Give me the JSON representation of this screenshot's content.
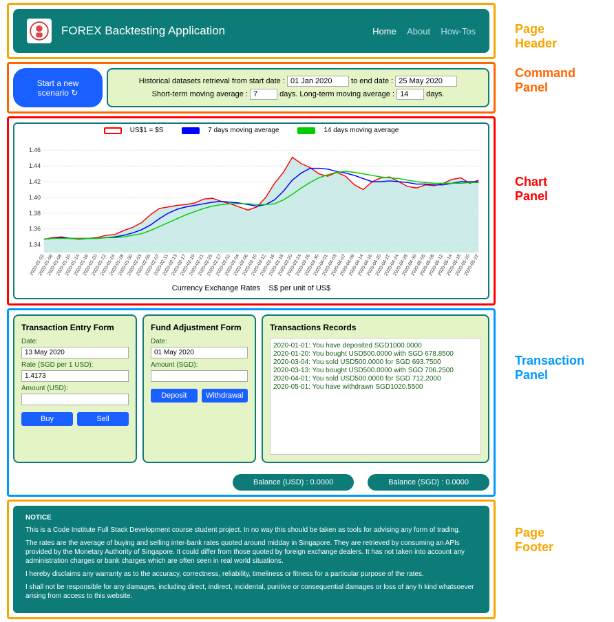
{
  "annotations": {
    "header": "Page\nHeader",
    "command": "Command\nPanel",
    "chart": "Chart\nPanel",
    "transaction": "Transaction\nPanel",
    "footer": "Page\nFooter"
  },
  "header": {
    "title": "FOREX Backtesting Application",
    "nav": {
      "home": "Home",
      "about": "About",
      "howtos": "How-Tos"
    }
  },
  "command": {
    "new_scenario": "Start a new scenario ↻",
    "hist_label_start": "Historical datasets retrieval from start date :",
    "start_date": "01 Jan 2020",
    "to_end": "to end date :",
    "end_date": "25 May 2020",
    "short_label": "Short-term moving average :",
    "short_val": "7",
    "long_label": "days. Long-term moving average :",
    "long_val": "14",
    "days_suffix": "days."
  },
  "chart": {
    "legend": {
      "raw": "US$1 = $S",
      "ma7": "7 days moving average",
      "ma14": "14 days moving average"
    },
    "caption": "Currency Exchange Rates    S$ per unit of US$"
  },
  "chart_data": {
    "type": "line",
    "xlabel": "",
    "ylabel": "",
    "ylim": [
      1.33,
      1.47
    ],
    "y_ticks": [
      1.34,
      1.36,
      1.38,
      1.4,
      1.42,
      1.44,
      1.46
    ],
    "x": [
      "2020-01-02",
      "2020-01-06",
      "2020-01-08",
      "2020-01-10",
      "2020-01-14",
      "2020-01-16",
      "2020-01-20",
      "2020-01-22",
      "2020-01-24",
      "2020-01-28",
      "2020-01-30",
      "2020-02-03",
      "2020-02-05",
      "2020-02-07",
      "2020-02-11",
      "2020-02-13",
      "2020-02-17",
      "2020-02-19",
      "2020-02-21",
      "2020-02-25",
      "2020-02-27",
      "2020-03-02",
      "2020-03-04",
      "2020-03-06",
      "2020-03-10",
      "2020-03-12",
      "2020-03-16",
      "2020-03-18",
      "2020-03-20",
      "2020-03-24",
      "2020-03-26",
      "2020-03-30",
      "2020-04-01",
      "2020-04-03",
      "2020-04-07",
      "2020-04-09",
      "2020-04-14",
      "2020-04-16",
      "2020-04-20",
      "2020-04-22",
      "2020-04-24",
      "2020-04-28",
      "2020-04-30",
      "2020-05-05",
      "2020-05-08",
      "2020-05-12",
      "2020-05-14",
      "2020-05-18",
      "2020-05-20",
      "2020-05-22"
    ],
    "series": [
      {
        "name": "US$1 = $S",
        "color": "#ff0000",
        "values": [
          1.347,
          1.349,
          1.35,
          1.348,
          1.347,
          1.348,
          1.349,
          1.352,
          1.353,
          1.358,
          1.362,
          1.368,
          1.378,
          1.386,
          1.388,
          1.39,
          1.391,
          1.393,
          1.398,
          1.399,
          1.395,
          1.392,
          1.388,
          1.384,
          1.388,
          1.4,
          1.418,
          1.432,
          1.451,
          1.443,
          1.438,
          1.43,
          1.427,
          1.432,
          1.427,
          1.416,
          1.41,
          1.42,
          1.425,
          1.426,
          1.42,
          1.414,
          1.412,
          1.416,
          1.415,
          1.418,
          1.423,
          1.425,
          1.418,
          1.422
        ]
      },
      {
        "name": "7 days moving average",
        "color": "#0000ff",
        "values": [
          1.347,
          1.348,
          1.349,
          1.348,
          1.348,
          1.348,
          1.348,
          1.349,
          1.35,
          1.352,
          1.355,
          1.359,
          1.365,
          1.373,
          1.38,
          1.385,
          1.388,
          1.39,
          1.392,
          1.394,
          1.395,
          1.394,
          1.393,
          1.391,
          1.389,
          1.391,
          1.397,
          1.408,
          1.422,
          1.431,
          1.437,
          1.437,
          1.436,
          1.433,
          1.431,
          1.428,
          1.424,
          1.42,
          1.42,
          1.421,
          1.42,
          1.419,
          1.417,
          1.417,
          1.416,
          1.416,
          1.418,
          1.42,
          1.42,
          1.42
        ]
      },
      {
        "name": "14 days moving average",
        "color": "#00cc00",
        "values": [
          1.347,
          1.348,
          1.348,
          1.348,
          1.348,
          1.348,
          1.348,
          1.349,
          1.349,
          1.35,
          1.352,
          1.354,
          1.358,
          1.363,
          1.368,
          1.373,
          1.378,
          1.382,
          1.386,
          1.389,
          1.391,
          1.392,
          1.392,
          1.392,
          1.391,
          1.391,
          1.392,
          1.397,
          1.404,
          1.412,
          1.419,
          1.425,
          1.429,
          1.432,
          1.433,
          1.432,
          1.43,
          1.428,
          1.426,
          1.425,
          1.424,
          1.422,
          1.42,
          1.419,
          1.418,
          1.418,
          1.418,
          1.418,
          1.419,
          1.419
        ]
      }
    ]
  },
  "txn": {
    "entry": {
      "title": "Transaction Entry Form",
      "date_label": "Date:",
      "date_val": "13 May 2020",
      "rate_label": "Rate (SGD per 1 USD):",
      "rate_val": "1.4173",
      "amount_label": "Amount (USD):",
      "amount_val": "",
      "buy": "Buy",
      "sell": "Sell"
    },
    "fund": {
      "title": "Fund Adjustment Form",
      "date_label": "Date:",
      "date_val": "01 May 2020",
      "amount_label": "Amount (SGD):",
      "amount_val": "",
      "deposit": "Deposit",
      "withdraw": "Withdrawal"
    },
    "records": {
      "title": "Transactions Records",
      "items": [
        "2020-01-01: You have deposited SGD1000.0000",
        "2020-01-20: You bought USD500.0000 with SGD 678.8500",
        "2020-03-04: You sold USD500.0000 for SGD 693.7500",
        "2020-03-13: You bought USD500.0000 with SGD 706.2500",
        "2020-04-01: You sold USD500.0000 for SGD 712.2000",
        "2020-05-01: You have withdrawn SGD1020.5500"
      ]
    },
    "balance_usd": "Balance (USD) : 0.0000",
    "balance_sgd": "Balance (SGD) : 0.0000"
  },
  "footer": {
    "title": "NOTICE",
    "p1": "This is a Code Institute Full Stack Development course student project. In no way this should be taken as tools for advising any form of trading.",
    "p2": "The rates are the average of buying and selling inter-bank rates quoted around midday in Singapore. They are retrieved by consuming an APIs provided by the Monetary Authority of Singapore. It could differ from those quoted by foreign exchange dealers. It has not taken into account any administration charges or bank charges which are often seen in real world situations.",
    "p3": "I hereby disclaims any warranty as to the accuracy, correctness, reliability, timeliness or fitness for a particular purpose of the rates.",
    "p4": "I shall not be responsible for any damages, including direct, indirect, incidental, punitive or consequential damages or loss of any h kind whatsoever arising from access to this website."
  }
}
